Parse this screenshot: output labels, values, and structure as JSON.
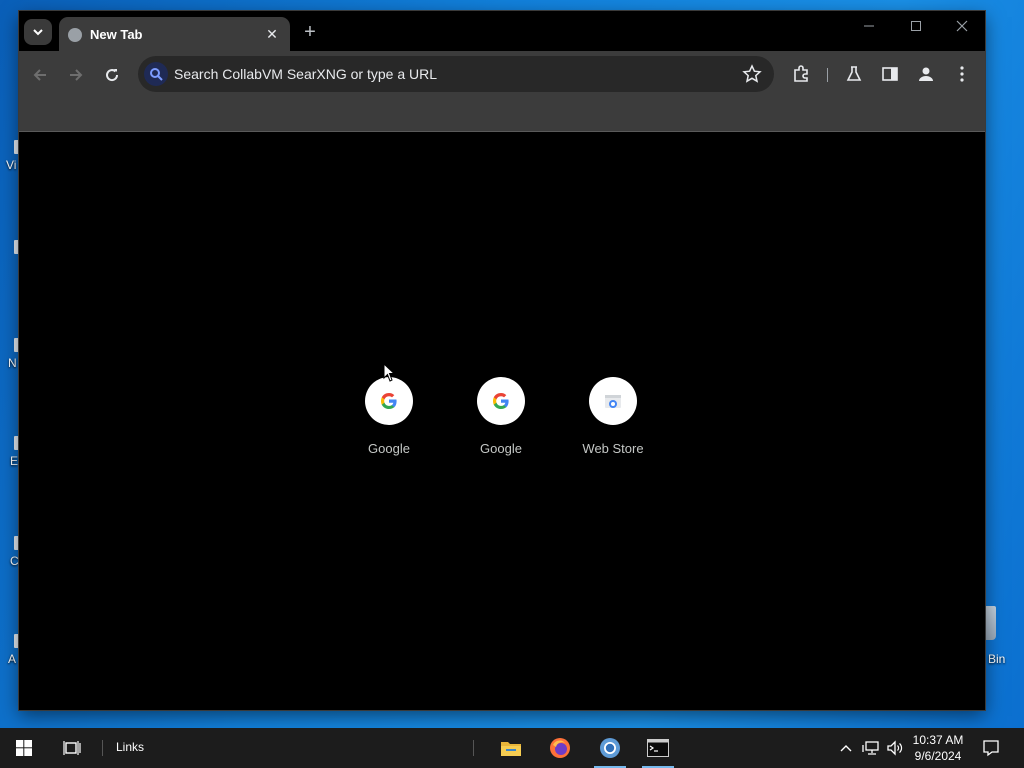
{
  "desktop": {
    "icon_fragments": [
      "Vi",
      "N",
      "E",
      "C",
      "A"
    ],
    "recycle_bin_label": "Bin"
  },
  "browser": {
    "tab": {
      "title": "New Tab"
    },
    "omnibox": {
      "placeholder": "Search CollabVM SearXNG or type a URL"
    },
    "shortcuts": [
      {
        "label": "Google",
        "icon": "google-g-icon"
      },
      {
        "label": "Google",
        "icon": "google-g-icon"
      },
      {
        "label": "Web Store",
        "icon": "web-store-icon"
      }
    ]
  },
  "taskbar": {
    "links_label": "Links",
    "clock": {
      "time": "10:37 AM",
      "date": "9/6/2024"
    },
    "pinned": [
      "file-explorer-icon",
      "firefox-icon",
      "chrome-icon",
      "terminal-icon"
    ]
  },
  "colors": {
    "desktop_blue": "#0078d7",
    "browser_toolbar": "#3c3c3c",
    "omnibox_bg": "#282828",
    "page_bg": "#000000"
  }
}
